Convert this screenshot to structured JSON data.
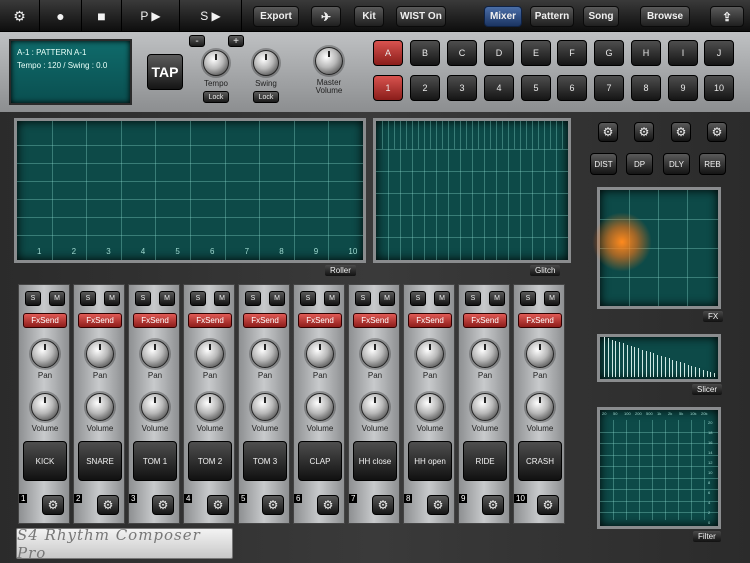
{
  "topbar": {
    "settings_icon": "gear-icon",
    "record_icon": "record-icon",
    "stop_icon": "stop-icon",
    "pattern_play": "P ▶",
    "song_play": "S ▶",
    "export": "Export",
    "airplane_icon": "airplane-icon",
    "kit": "Kit",
    "wist": "WIST On",
    "mixer": "Mixer",
    "pattern": "Pattern",
    "song": "Song",
    "browse": "Browse",
    "share_icon": "share-icon"
  },
  "display": {
    "line1": "A-1 : PATTERN A-1",
    "line2": "Tempo : 120 / Swing : 0.0"
  },
  "controls": {
    "tap": "TAP",
    "minus": "-",
    "plus": "+",
    "tempo": "Tempo",
    "swing": "Swing",
    "lock": "Lock",
    "master_volume_1": "Master",
    "master_volume_2": "Volume"
  },
  "pattern_banks": [
    "A",
    "B",
    "C",
    "D",
    "E",
    "F",
    "G",
    "H",
    "I",
    "J"
  ],
  "pattern_numbers": [
    "1",
    "2",
    "3",
    "4",
    "5",
    "6",
    "7",
    "8",
    "9",
    "10"
  ],
  "roller": {
    "label": "Roller",
    "steps": [
      "1",
      "2",
      "3",
      "4",
      "5",
      "6",
      "7",
      "8",
      "9",
      "10"
    ]
  },
  "glitch": {
    "label": "Glitch"
  },
  "fx_buttons": [
    "DIST",
    "DP",
    "DLY",
    "REB"
  ],
  "fx_labels": {
    "fx": "FX",
    "slicer": "Slicer",
    "filter": "Filter"
  },
  "filter_ticks": [
    "20",
    "50",
    "100",
    "200",
    "500",
    "1k",
    "2k",
    "5k",
    "10k",
    "20k"
  ],
  "filter_yticks": [
    "20",
    "18",
    "16",
    "14",
    "12",
    "10",
    "8",
    "6",
    "4",
    "2",
    "0"
  ],
  "channel": {
    "solo": "S",
    "mute": "M",
    "fxsend": "FxSend",
    "pan": "Pan",
    "volume": "Volume"
  },
  "channels": [
    {
      "num": "1",
      "name": "KICK"
    },
    {
      "num": "2",
      "name": "SNARE"
    },
    {
      "num": "3",
      "name": "TOM 1"
    },
    {
      "num": "4",
      "name": "TOM 2"
    },
    {
      "num": "5",
      "name": "TOM 3"
    },
    {
      "num": "6",
      "name": "CLAP"
    },
    {
      "num": "7",
      "name": "HH close"
    },
    {
      "num": "8",
      "name": "HH open"
    },
    {
      "num": "9",
      "name": "RIDE"
    },
    {
      "num": "10",
      "name": "CRASH"
    }
  ],
  "logo": "S4 Rhythm Composer Pro",
  "colors": {
    "accent_red": "#c0302b",
    "screen_teal": "#0d4a48",
    "mixer_active": "#2b4f8a"
  }
}
